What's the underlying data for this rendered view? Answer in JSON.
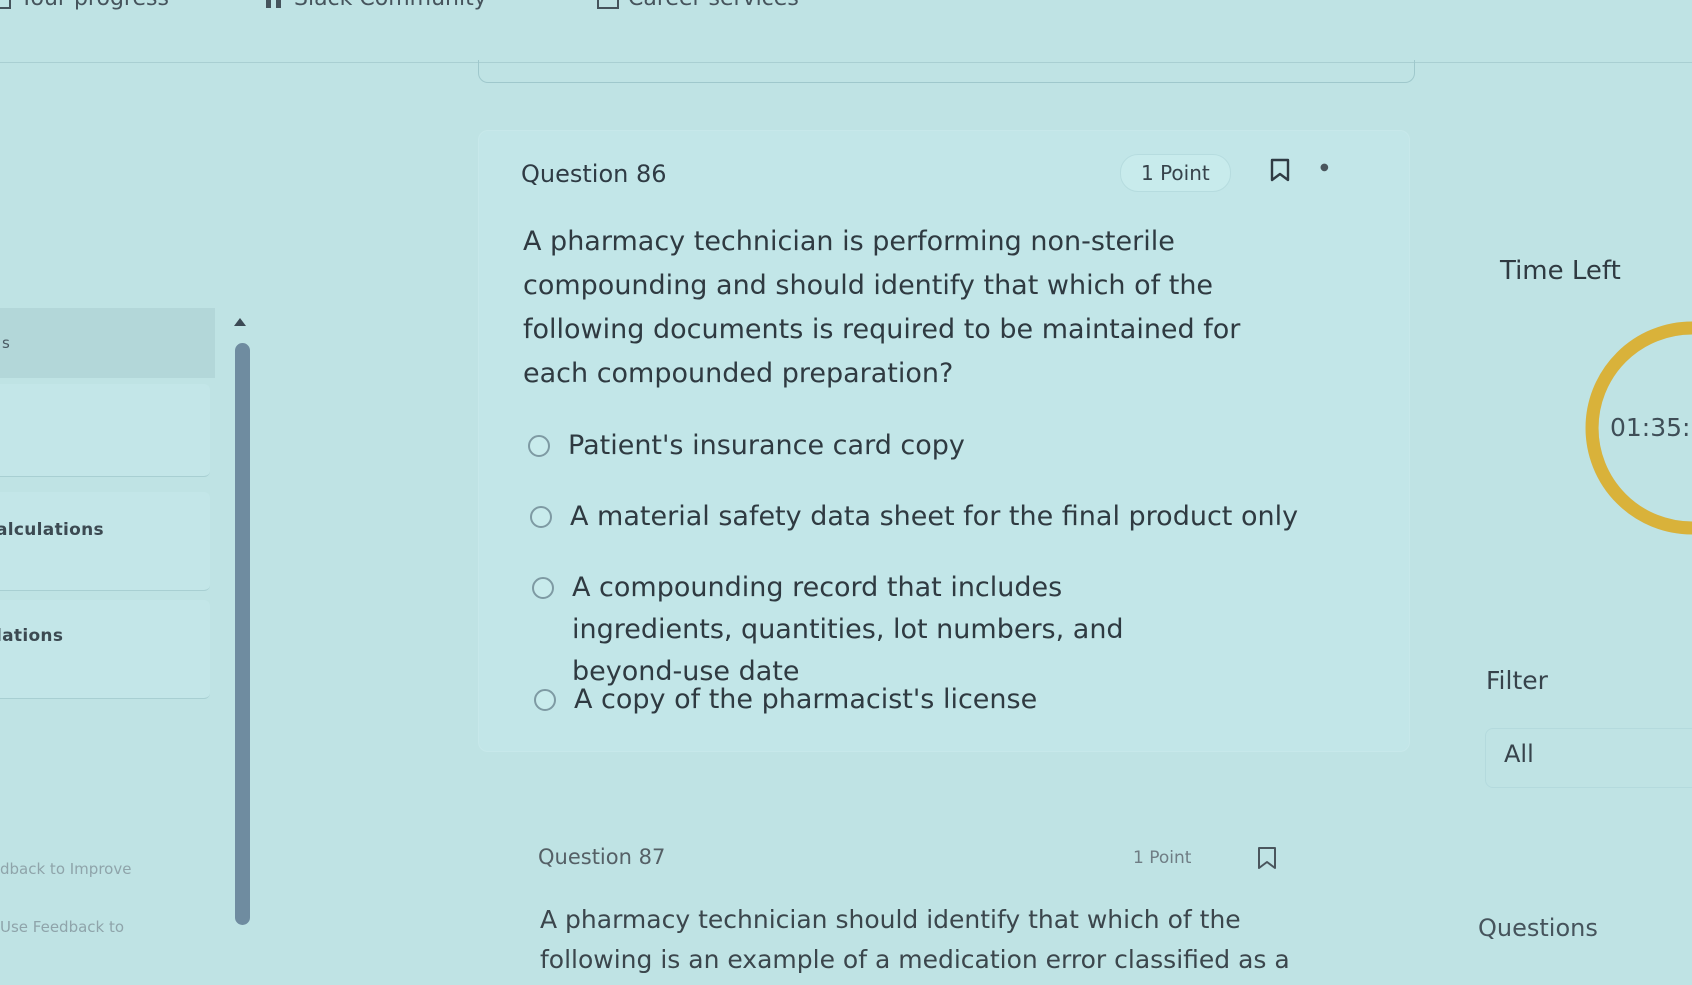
{
  "topbar": {
    "progress_label": "Your progress",
    "community_label": "Slack Community",
    "career_label": "Career services"
  },
  "sidebar": {
    "header_text": "s",
    "item_calculations": "alculations",
    "item_regulations": "lations",
    "faint_1": "dback to Improve",
    "faint_2": "Use Feedback to"
  },
  "question86": {
    "title": "Question 86",
    "points": "1 Point",
    "text": "A pharmacy technician is performing non-sterile compounding and should identify that which of the following documents is required to be maintained for each compounded preparation?",
    "options": [
      "Patient's insurance card copy",
      "A material safety data sheet for the final product only",
      "A compounding record that includes ingredients, quantities, lot numbers, and beyond-use date",
      "A copy of the pharmacist's license"
    ]
  },
  "question87": {
    "title": "Question 87",
    "points": "1 Point",
    "text": "A pharmacy technician should identify that which of the following is an example of a medication error classified as a"
  },
  "timer": {
    "label": "Time Left",
    "value": "01:35:",
    "ring_color": "#d9b23a",
    "progress_fraction": 0.5
  },
  "filter": {
    "label": "Filter",
    "value": "All"
  },
  "questions_panel": {
    "label": "Questions"
  },
  "icons": {
    "bookmark": "bookmark-icon",
    "more": "more-icon",
    "slack": "slack-icon",
    "progress": "progress-icon",
    "career": "briefcase-icon"
  }
}
